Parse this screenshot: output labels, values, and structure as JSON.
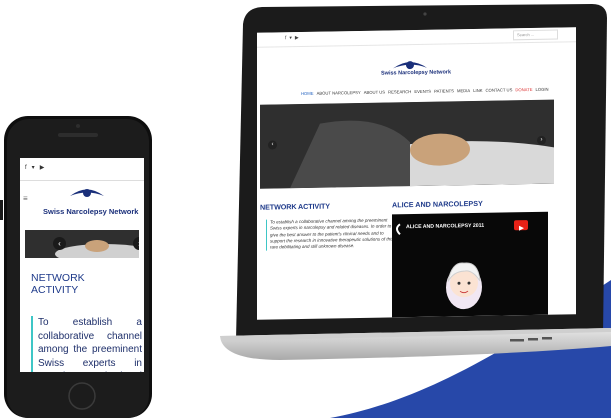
{
  "laptop": {
    "social_icons": [
      "facebook-icon",
      "twitter-icon",
      "youtube-icon"
    ],
    "search_placeholder": "Search ...",
    "logo_text": "Swiss Narcolepsy Network",
    "nav": [
      "HOME",
      "ABOUT NARCOLEPSY",
      "ABOUT US",
      "RESEARCH",
      "EVENTS",
      "PATIENTS",
      "MEDIA",
      "LINK",
      "CONTACT US",
      "DONATE",
      "LOGIN"
    ],
    "section_left_title": "NETWORK ACTIVITY",
    "section_left_text": "To establish a collaborative channel among the preeminent Swiss experts in narcolepsy and related diseases. In order to give the best answer to the patient's clinical needs and to support the research in innovative therapeutic solutions of this rare debilitating and still unknown disease.",
    "section_right_title": "ALICE AND NARCOLEPSY",
    "video_title": "ALICE AND NARCOLEPSY 2011"
  },
  "phone": {
    "social_icons": [
      "facebook-icon",
      "twitter-icon",
      "youtube-icon"
    ],
    "logo_text": "Swiss Narcolepsy Network",
    "title": "NETWORK ACTIVITY",
    "text": "To establish a collaborative channel among the preeminent Swiss experts in narcolepsy and related"
  },
  "colors": {
    "brand_blue": "#1e3a8a",
    "wave_blue": "#2748a9",
    "accent_teal": "#3ec6c6",
    "donate_red": "#d33333"
  }
}
